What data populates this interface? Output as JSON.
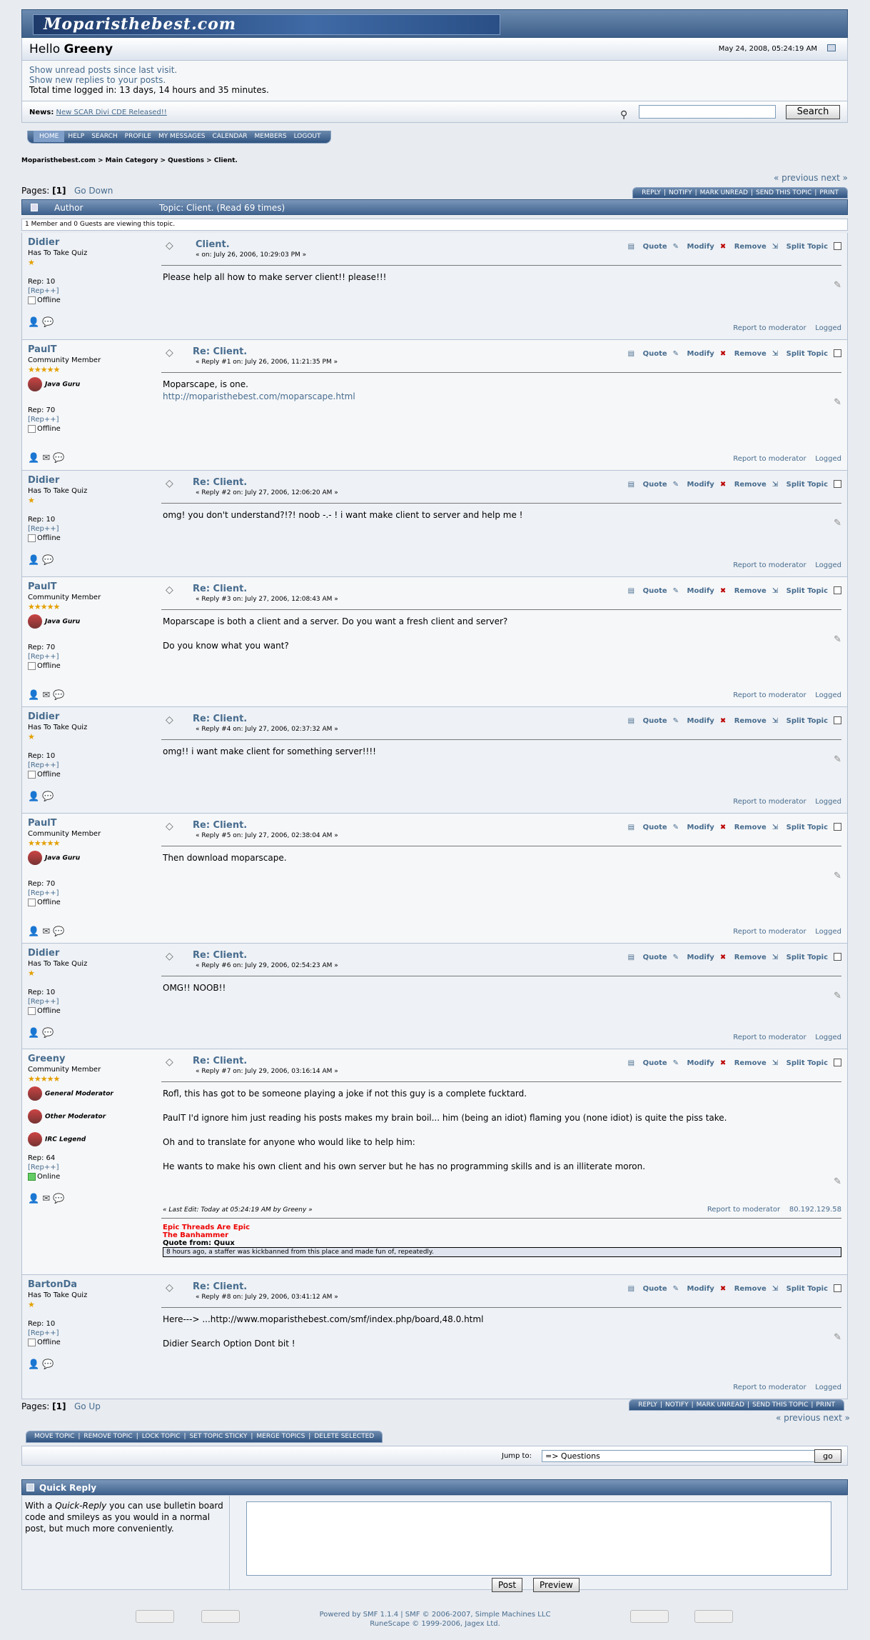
{
  "site": {
    "logo": "Moparisthebest.com",
    "hello_prefix": "Hello ",
    "user": "Greeny",
    "date": "May 24, 2008, 05:24:19 AM"
  },
  "panel": {
    "unread": "Show unread posts since last visit.",
    "replies": "Show new replies to your posts.",
    "time": "Total time logged in: 13 days, 14 hours and 35 minutes."
  },
  "news": {
    "label": "News:",
    "link": "New SCAR Divi CDE Released!!",
    "search_btn": "Search"
  },
  "menu": [
    "HOME",
    "HELP",
    "SEARCH",
    "PROFILE",
    "MY MESSAGES",
    "CALENDAR",
    "MEMBERS",
    "LOGOUT"
  ],
  "breadcrumb": "Moparisthebest.com > Main Category > Questions > Client.",
  "nav": {
    "prev": "« previous",
    "next": "next »",
    "pages_label": "Pages: ",
    "page": "[1]",
    "go_down": "Go Down",
    "go_up": "Go Up"
  },
  "actions": [
    "REPLY",
    "NOTIFY",
    "MARK UNREAD",
    "SEND THIS TOPIC",
    "PRINT"
  ],
  "topic": {
    "author": "Author",
    "title": "Topic: Client.  (Read 69 times)",
    "viewing": "1 Member and 0 Guests are viewing this topic."
  },
  "labels": {
    "quote": "Quote",
    "modify": "Modify",
    "remove": "Remove",
    "split": "Split Topic",
    "report": "Report to moderator",
    "logged": "Logged",
    "rep_plus": "[Rep++]",
    "offline": "Offline",
    "online": "Online"
  },
  "posts": [
    {
      "name": "Didier",
      "group": "Has To Take Quiz",
      "stars": "★",
      "rep": "Rep: 10",
      "title": "Client.",
      "date": "« on: July 26, 2006, 10:29:03 PM »",
      "body": [
        "Please help all how to make server client!! please!!!"
      ]
    },
    {
      "name": "PaulT",
      "group": "Community Member",
      "stars": "★★★★★",
      "badge": "Java Guru",
      "rep": "Rep: 70",
      "title": "Re: Client.",
      "date": "« Reply #1 on: July 26, 2006, 11:21:35 PM »",
      "body": [
        "Moparscape, is one.",
        "http://moparisthebest.com/moparscape.html"
      ]
    },
    {
      "name": "Didier",
      "group": "Has To Take Quiz",
      "stars": "★",
      "rep": "Rep: 10",
      "title": "Re: Client.",
      "date": "« Reply #2 on: July 27, 2006, 12:06:20 AM »",
      "body": [
        "omg! you don't understand?!?! noob -.- ! i want make client to server and help me !"
      ]
    },
    {
      "name": "PaulT",
      "group": "Community Member",
      "stars": "★★★★★",
      "badge": "Java Guru",
      "rep": "Rep: 70",
      "title": "Re: Client.",
      "date": "« Reply #3 on: July 27, 2006, 12:08:43 AM »",
      "body": [
        "Moparscape is both a client and a server. Do you want a fresh client and server?",
        "",
        "Do you know what you want?"
      ]
    },
    {
      "name": "Didier",
      "group": "Has To Take Quiz",
      "stars": "★",
      "rep": "Rep: 10",
      "title": "Re: Client.",
      "date": "« Reply #4 on: July 27, 2006, 02:37:32 AM »",
      "body": [
        "omg!! i want make client for something server!!!!"
      ]
    },
    {
      "name": "PaulT",
      "group": "Community Member",
      "stars": "★★★★★",
      "badge": "Java Guru",
      "rep": "Rep: 70",
      "title": "Re: Client.",
      "date": "« Reply #5 on: July 27, 2006, 02:38:04 AM »",
      "body": [
        "Then download moparscape."
      ]
    },
    {
      "name": "Didier",
      "group": "Has To Take Quiz",
      "stars": "★",
      "rep": "Rep: 10",
      "title": "Re: Client.",
      "date": "« Reply #6 on: July 29, 2006, 02:54:23 AM »",
      "body": [
        "OMG!! NOOB!!"
      ]
    },
    {
      "name": "Greeny",
      "group": "Community Member",
      "stars": "★★★★★",
      "badges": [
        "General Moderator",
        "Other Moderator",
        "IRC Legend"
      ],
      "rep": "Rep: 64",
      "title": "Re: Client.",
      "date": "« Reply #7 on: July 29, 2006, 03:16:14 AM »",
      "body": [
        "Rofl, this has got to be someone playing a joke if not this guy is a complete fucktard.",
        "",
        "PaulT I'd ignore him just reading his posts makes my brain boil... him (being an idiot) flaming you (none idiot) is quite the piss take.",
        "",
        "Oh and to translate for anyone who would like to help him:",
        "",
        "He wants to make his own client and his own server but he has no programming skills and is an illiterate moron."
      ],
      "last_edit": "« Last Edit: Today at 05:24:19 AM by Greeny »",
      "ip": "80.192.129.58",
      "sig": [
        "Epic Threads Are Epic",
        "The Banhammer",
        "Quote from: Quux",
        "8 hours ago, a staffer was kickbanned from this place and made fun of, repeatedly."
      ]
    },
    {
      "name": "BartonDa",
      "group": "Has To Take Quiz",
      "stars": "★",
      "rep": "Rep: 10",
      "title": "Re: Client.",
      "date": "« Reply #8 on: July 29, 2006, 03:41:12 AM »",
      "body": [
        "Here---> ...http://www.moparisthebest.com/smf/index.php/board,48.0.html",
        "",
        "Didier Search Option Dont bit !"
      ]
    }
  ],
  "moderation": [
    "MOVE TOPIC",
    "REMOVE TOPIC",
    "LOCK TOPIC",
    "SET TOPIC STICKY",
    "MERGE TOPICS",
    "DELETE SELECTED"
  ],
  "jump": {
    "label": "Jump to:",
    "value": "=> Questions",
    "go": "go"
  },
  "quick_reply": {
    "title": "Quick Reply",
    "text_pre": "With a ",
    "text_em": "Quick-Reply",
    "text_post": " you can use bulletin board code and smileys as you would in a normal post, but much more conveniently.",
    "post": "Post",
    "preview": "Preview"
  },
  "footer": {
    "line1": "Powered by SMF 1.1.4 | SMF © 2006-2007, Simple Machines LLC",
    "line2": "RuneScape © 1999-2006, Jagex Ltd."
  }
}
